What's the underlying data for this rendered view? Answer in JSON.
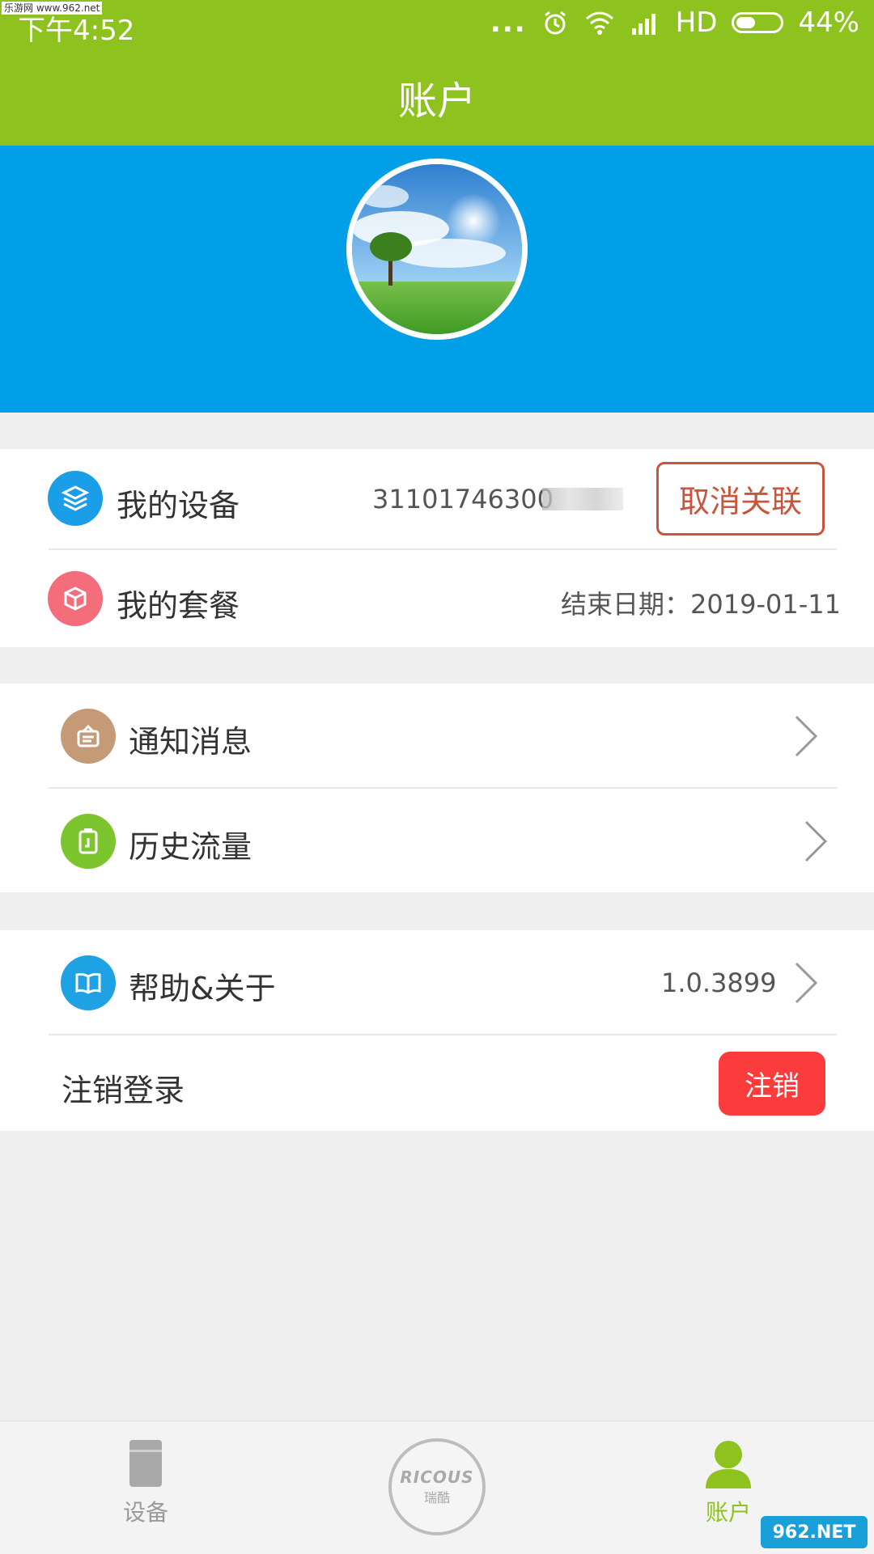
{
  "status_bar": {
    "watermark": "乐游网 www.962.net",
    "time": "下午4:52",
    "dots": "...",
    "network": "HD",
    "battery_level": 0.44,
    "battery_text": "44%"
  },
  "title_bar": {
    "title": "账户"
  },
  "account_section": {
    "device_label": "我的设备",
    "device_value": "31101746300",
    "unlink_button": "取消关联",
    "plan_label": "我的套餐",
    "plan_value": "结束日期：2019-01-11"
  },
  "menu_section": {
    "notifications_label": "通知消息",
    "history_label": "历史流量"
  },
  "about_section": {
    "help_label": "帮助&关于",
    "version": "1.0.3899",
    "logout_label": "注销登录",
    "logout_button": "注销"
  },
  "tab_bar": {
    "device_tab": "设备",
    "center_brand": "RICOUS",
    "center_brand_cn": "瑞酷",
    "account_tab": "账户",
    "active_color": "#8dc21f",
    "inactive_color": "#9a9a9a"
  },
  "corner_watermark": "962.NET"
}
